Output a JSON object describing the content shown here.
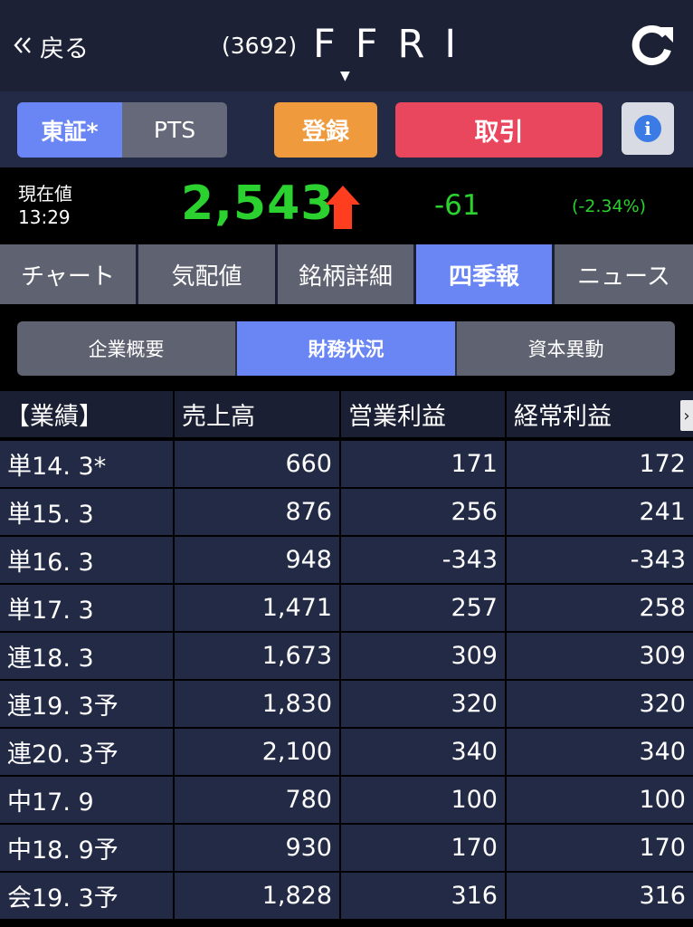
{
  "header": {
    "back_label": "戻る",
    "back_icon": "double-chevron-left-icon",
    "stock_code": "(3692)",
    "stock_name": "FFRI",
    "refresh_icon": "refresh-icon"
  },
  "market_toggle": {
    "options": [
      "東証*",
      "PTS"
    ],
    "selected": "東証*"
  },
  "actions": {
    "register_label": "登録",
    "trade_label": "取引",
    "info_icon": "info-icon"
  },
  "price": {
    "label": "現在値",
    "time": "13:29",
    "value": "2,543",
    "direction": "up",
    "change": "-61",
    "change_pct": "(-2.34%)"
  },
  "tabs": [
    {
      "label": "チャート",
      "active": false
    },
    {
      "label": "気配値",
      "active": false
    },
    {
      "label": "銘柄詳細",
      "active": false
    },
    {
      "label": "四季報",
      "active": true
    },
    {
      "label": "ニュース",
      "active": false
    }
  ],
  "subtabs": [
    {
      "label": "企業概要",
      "active": false
    },
    {
      "label": "財務状況",
      "active": true
    },
    {
      "label": "資本異動",
      "active": false
    }
  ],
  "table": {
    "headers": [
      "【業績】",
      "売上高",
      "営業利益",
      "経常利益"
    ],
    "scroll_indicator": "›",
    "rows": [
      [
        "単14. 3*",
        "660",
        "171",
        "172"
      ],
      [
        "単15. 3",
        "876",
        "256",
        "241"
      ],
      [
        "単16. 3",
        "948",
        "-343",
        "-343"
      ],
      [
        "単17. 3",
        "1,471",
        "257",
        "258"
      ],
      [
        "連18. 3",
        "1,673",
        "309",
        "309"
      ],
      [
        "連19. 3予",
        "1,830",
        "320",
        "320"
      ],
      [
        "連20. 3予",
        "2,100",
        "340",
        "340"
      ],
      [
        "中17. 9",
        "780",
        "100",
        "100"
      ],
      [
        "中18. 9予",
        "930",
        "170",
        "170"
      ],
      [
        "会19. 3予",
        "1,828",
        "316",
        "316"
      ]
    ]
  },
  "colors": {
    "accent": "#6a86f5",
    "price_up": "#2bd12f",
    "arrow": "#ff3d1f",
    "register": "#ef9a3c",
    "trade": "#e9475e"
  }
}
